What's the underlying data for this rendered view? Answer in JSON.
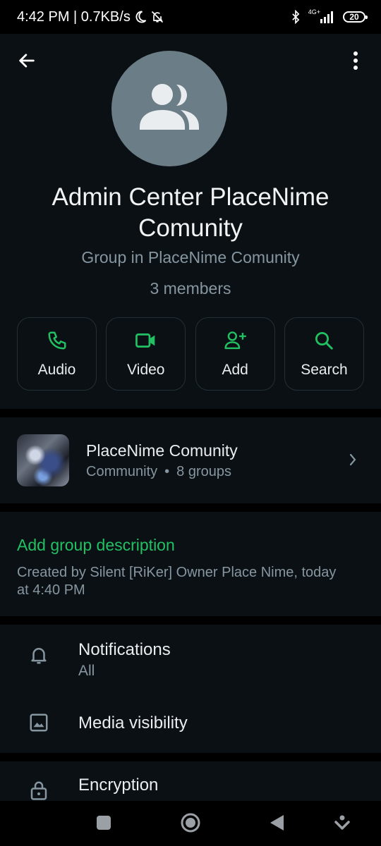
{
  "status_bar": {
    "time_speed": "4:42 PM | 0.7KB/s",
    "network": "4G+",
    "battery": "20"
  },
  "header": {
    "title": "Admin Center PlaceNime Comunity",
    "subtitle": "Group in PlaceNime Comunity",
    "members": "3 members",
    "icons": {
      "back": "arrow-left-icon",
      "menu": "more-vert-icon",
      "avatar": "group-icon"
    }
  },
  "actions": [
    {
      "label": "Audio",
      "icon": "phone-icon"
    },
    {
      "label": "Video",
      "icon": "video-icon"
    },
    {
      "label": "Add",
      "icon": "person-add-icon"
    },
    {
      "label": "Search",
      "icon": "search-icon"
    }
  ],
  "community": {
    "name": "PlaceNime Comunity",
    "type": "Community",
    "separator": "•",
    "groups": "8 groups"
  },
  "description": {
    "add_label": "Add group description",
    "created_text": "Created by Silent [RiKer] Owner Place Nime, today at 4:40 PM"
  },
  "settings": {
    "notifications": {
      "label": "Notifications",
      "value": "All"
    },
    "media_visibility": {
      "label": "Media visibility"
    },
    "encryption": {
      "label": "Encryption"
    }
  },
  "colors": {
    "accent": "#21c063",
    "surface": "#0b1014",
    "background": "#000000",
    "secondary_text": "#8696a0",
    "avatar_bg": "#6b7d86"
  }
}
